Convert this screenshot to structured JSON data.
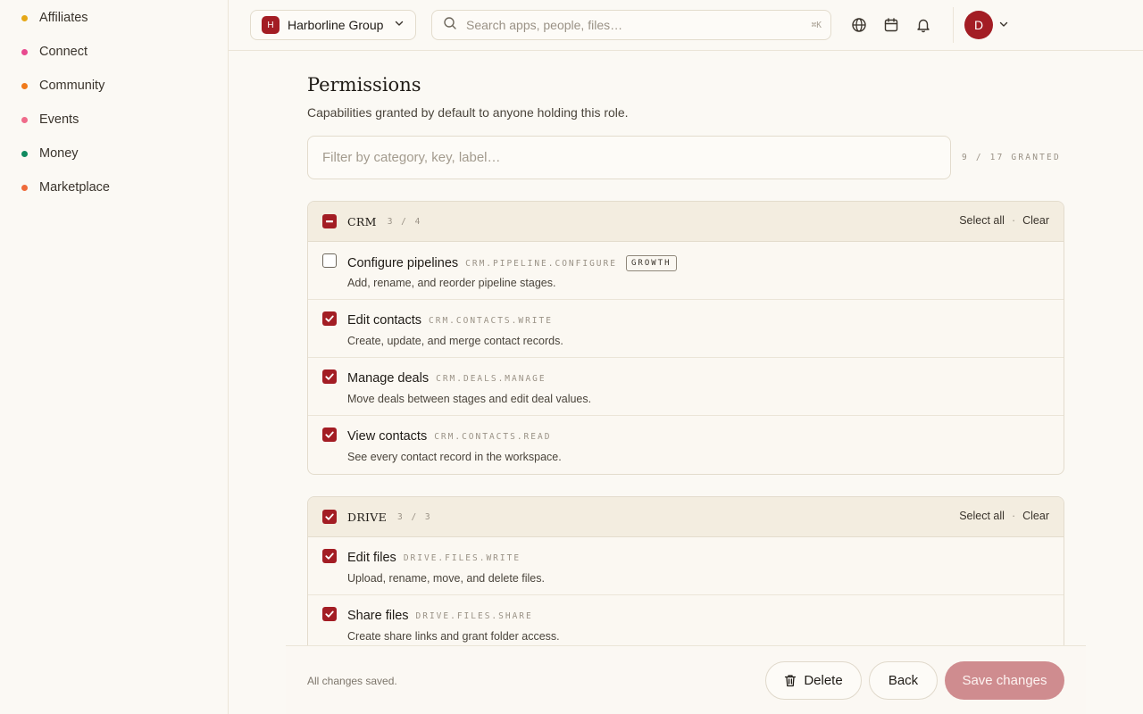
{
  "sidebar": {
    "items": [
      {
        "label": "Affiliates",
        "color": "#e6a817"
      },
      {
        "label": "Connect",
        "color": "#e84a8f"
      },
      {
        "label": "Community",
        "color": "#f07a1a"
      },
      {
        "label": "Events",
        "color": "#ef6b8a"
      },
      {
        "label": "Money",
        "color": "#0f8a5f"
      },
      {
        "label": "Marketplace",
        "color": "#ef6b3a"
      }
    ]
  },
  "topbar": {
    "org_initial": "H",
    "org_name": "Harborline Group",
    "search_placeholder": "Search apps, people, files…",
    "search_shortcut": "⌘K",
    "avatar_initial": "D"
  },
  "page": {
    "title": "Permissions",
    "subtitle": "Capabilities granted by default to anyone holding this role.",
    "filter_placeholder": "Filter by category, key, label…",
    "granted_summary": "9 / 17 GRANTED"
  },
  "groups": [
    {
      "name": "CRM",
      "count": "3 / 4",
      "state": "partial",
      "select_all_label": "Select all",
      "separator": "·",
      "clear_label": "Clear",
      "items": [
        {
          "label": "Configure pipelines",
          "key": "CRM.PIPELINE.CONFIGURE",
          "tag": "GROWTH",
          "desc": "Add, rename, and reorder pipeline stages.",
          "checked": false
        },
        {
          "label": "Edit contacts",
          "key": "CRM.CONTACTS.WRITE",
          "tag": "",
          "desc": "Create, update, and merge contact records.",
          "checked": true
        },
        {
          "label": "Manage deals",
          "key": "CRM.DEALS.MANAGE",
          "tag": "",
          "desc": "Move deals between stages and edit deal values.",
          "checked": true
        },
        {
          "label": "View contacts",
          "key": "CRM.CONTACTS.READ",
          "tag": "",
          "desc": "See every contact record in the workspace.",
          "checked": true
        }
      ]
    },
    {
      "name": "DRIVE",
      "count": "3 / 3",
      "state": "full",
      "select_all_label": "Select all",
      "separator": "·",
      "clear_label": "Clear",
      "items": [
        {
          "label": "Edit files",
          "key": "DRIVE.FILES.WRITE",
          "tag": "",
          "desc": "Upload, rename, move, and delete files.",
          "checked": true
        },
        {
          "label": "Share files",
          "key": "DRIVE.FILES.SHARE",
          "tag": "",
          "desc": "Create share links and grant folder access.",
          "checked": true
        }
      ]
    }
  ],
  "footer": {
    "status": "All changes saved.",
    "delete_label": "Delete",
    "back_label": "Back",
    "save_label": "Save changes"
  },
  "colors": {
    "accent": "#a31d24",
    "save_disabled": "#cf8c8f"
  }
}
